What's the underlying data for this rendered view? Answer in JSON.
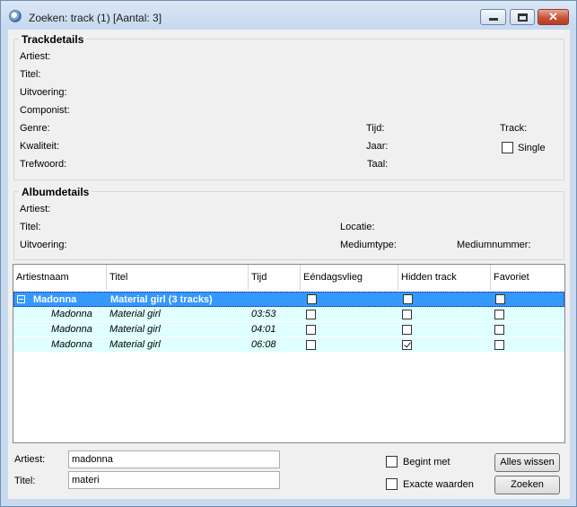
{
  "window": {
    "title": "Zoeken: track (1) [Aantal: 3]"
  },
  "trackdetails": {
    "title": "Trackdetails",
    "artiest": "Artiest:",
    "titel": "Titel:",
    "uitvoering": "Uitvoering:",
    "componist": "Componist:",
    "genre": "Genre:",
    "kwaliteit": "Kwaliteit:",
    "trefwoord": "Trefwoord:",
    "tijd": "Tijd:",
    "jaar": "Jaar:",
    "taal": "Taal:",
    "track": "Track:",
    "single": "Single",
    "single_checked": false
  },
  "albumdetails": {
    "title": "Albumdetails",
    "artiest": "Artiest:",
    "titel": "Titel:",
    "uitvoering": "Uitvoering:",
    "locatie": "Locatie:",
    "mediumtype": "Mediumtype:",
    "mediumnummer": "Mediumnummer:"
  },
  "grid": {
    "columns": [
      "Artiestnaam",
      "Titel",
      "Tijd",
      "Eéndagsvlieg",
      "Hidden track",
      "Favoriet"
    ],
    "group": {
      "artist": "Madonna",
      "title": "Material girl (3 tracks)",
      "expanded": true
    },
    "rows": [
      {
        "artist": "Madonna",
        "title": "Material girl",
        "time": "03:53",
        "eendagsvlieg": false,
        "hidden": false,
        "favoriet": false
      },
      {
        "artist": "Madonna",
        "title": "Material girl",
        "time": "04:01",
        "eendagsvlieg": false,
        "hidden": false,
        "favoriet": false
      },
      {
        "artist": "Madonna",
        "title": "Material girl",
        "time": "06:08",
        "eendagsvlieg": false,
        "hidden": true,
        "favoriet": false
      }
    ]
  },
  "search": {
    "artiest_label": "Artiest:",
    "artiest_value": "madonna",
    "titel_label": "Titel:",
    "titel_value": "materi",
    "begint_met": "Begint met",
    "begint_met_checked": false,
    "exacte_waarden": "Exacte waarden",
    "exacte_waarden_checked": false,
    "clear_button": "Alles wissen",
    "search_button": "Zoeken"
  }
}
